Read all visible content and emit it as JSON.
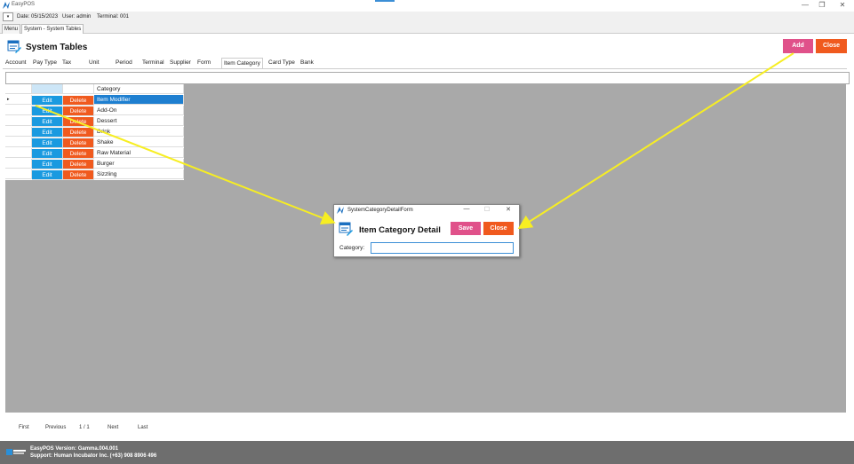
{
  "app": {
    "title": "EasyPOS",
    "window_controls": [
      "—",
      "❐",
      "✕"
    ]
  },
  "info": {
    "dropdown": "▾",
    "date": "Date: 05/15/2023",
    "user": "User: admin",
    "terminal": "Terminal: 001"
  },
  "doc_tabs": {
    "menu": "Menu",
    "system": "System - System Tables"
  },
  "header": {
    "title": "System Tables",
    "icon": "table-edit-icon",
    "add_label": "Add",
    "close_label": "Close"
  },
  "tabs": [
    {
      "label": "Account"
    },
    {
      "label": "Pay Type"
    },
    {
      "label": "Tax"
    },
    {
      "label": "Unit"
    },
    {
      "label": "Period"
    },
    {
      "label": "Terminal"
    },
    {
      "label": "Supplier"
    },
    {
      "label": "Form"
    },
    {
      "label": "Item Category"
    },
    {
      "label": "Card Type"
    },
    {
      "label": "Bank"
    }
  ],
  "active_tab": "Item Category",
  "grid": {
    "header": "Category",
    "edit_label": "Edit",
    "delete_label": "Delete",
    "row_indicator": "▸",
    "rows": [
      "Item Modifier",
      "Add-On",
      "Dessert",
      "Drink",
      "Shake",
      "Raw Material",
      "Burger",
      "Sizzling"
    ],
    "selected_row": 0
  },
  "pager": {
    "first": "First",
    "previous": "Previous",
    "page": "1 / 1",
    "next": "Next",
    "last": "Last"
  },
  "status": {
    "version": "EasyPOS Version: Gamma.004.001",
    "support": "Support: Human Incubator Inc. (+63) 908 8906 496"
  },
  "dialog": {
    "window_title": "SystemCategoryDetailForm",
    "minimize": "—",
    "maximize": "☐",
    "close_x": "✕",
    "heading": "Item Category Detail",
    "save_label": "Save",
    "close_label": "Close",
    "category_label": "Category:",
    "category_value": ""
  },
  "colors": {
    "add": "#e0518a",
    "close": "#f05a1e",
    "edit": "#1a9ae0",
    "delete": "#f05a1e",
    "selected": "#1e7fd0",
    "arrow": "#f7ee22"
  }
}
